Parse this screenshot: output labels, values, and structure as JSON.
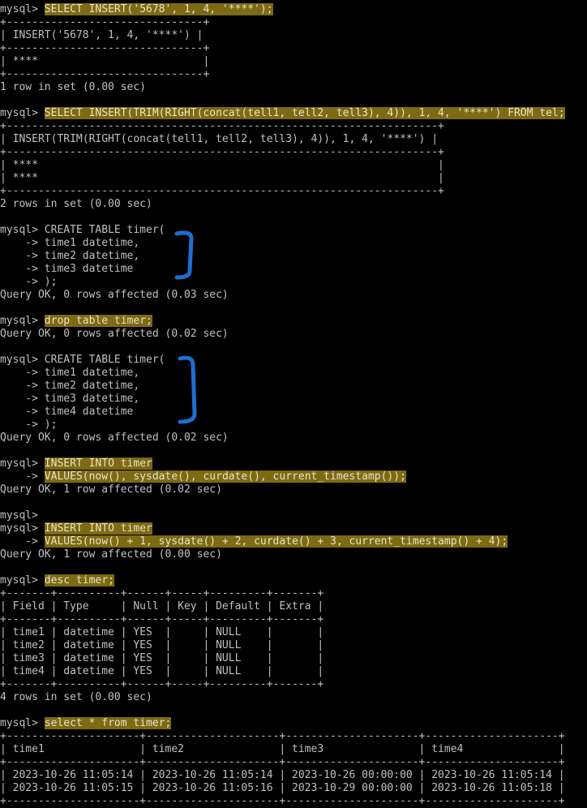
{
  "terminal": {
    "highlight_color": "#7d6a12",
    "text_color": "#c0c0c0",
    "background": "#000000",
    "annotation_color": "#1e6fd0",
    "lines": [
      {
        "segs": [
          {
            "t": "mysql> "
          },
          {
            "t": "SELECT INSERT('5678', 1, 4, '****');",
            "hl": true
          }
        ]
      },
      {
        "segs": [
          {
            "t": "+-------------------------------+"
          }
        ]
      },
      {
        "segs": [
          {
            "t": "| INSERT('5678', 1, 4, '****') |"
          }
        ]
      },
      {
        "segs": [
          {
            "t": "+-------------------------------+"
          }
        ]
      },
      {
        "segs": [
          {
            "t": "| ****                          |"
          }
        ]
      },
      {
        "segs": [
          {
            "t": "+-------------------------------+"
          }
        ]
      },
      {
        "segs": [
          {
            "t": "1 row in set (0.00 sec)"
          }
        ]
      },
      {
        "segs": [
          {
            "t": ""
          }
        ]
      },
      {
        "segs": [
          {
            "t": "mysql> "
          },
          {
            "t": "SELECT INSERT(TRIM(RIGHT(concat(tell1, tell2, tell3), 4)), 1, 4, '****') FROM tel;",
            "hl": true
          }
        ]
      },
      {
        "segs": [
          {
            "t": "+--------------------------------------------------------------------+"
          }
        ]
      },
      {
        "segs": [
          {
            "t": "| INSERT(TRIM(RIGHT(concat(tell1, tell2, tell3), 4)), 1, 4, '****') |"
          }
        ]
      },
      {
        "segs": [
          {
            "t": "+--------------------------------------------------------------------+"
          }
        ]
      },
      {
        "segs": [
          {
            "t": "| ****                                                               |"
          }
        ]
      },
      {
        "segs": [
          {
            "t": "| ****                                                               |"
          }
        ]
      },
      {
        "segs": [
          {
            "t": "+--------------------------------------------------------------------+"
          }
        ]
      },
      {
        "segs": [
          {
            "t": "2 rows in set (0.00 sec)"
          }
        ]
      },
      {
        "segs": [
          {
            "t": ""
          }
        ]
      },
      {
        "segs": [
          {
            "t": "mysql> CREATE TABLE timer("
          }
        ]
      },
      {
        "segs": [
          {
            "t": "    -> time1 datetime,"
          }
        ]
      },
      {
        "segs": [
          {
            "t": "    -> time2 datetime,"
          }
        ]
      },
      {
        "segs": [
          {
            "t": "    -> time3 datetime"
          }
        ]
      },
      {
        "segs": [
          {
            "t": "    -> );"
          }
        ]
      },
      {
        "segs": [
          {
            "t": "Query OK, 0 rows affected (0.03 sec)"
          }
        ]
      },
      {
        "segs": [
          {
            "t": ""
          }
        ]
      },
      {
        "segs": [
          {
            "t": "mysql> "
          },
          {
            "t": "drop table timer;",
            "hl": true
          }
        ]
      },
      {
        "segs": [
          {
            "t": "Query OK, 0 rows affected (0.02 sec)"
          }
        ]
      },
      {
        "segs": [
          {
            "t": ""
          }
        ]
      },
      {
        "segs": [
          {
            "t": "mysql> CREATE TABLE timer("
          }
        ]
      },
      {
        "segs": [
          {
            "t": "    -> time1 datetime,"
          }
        ]
      },
      {
        "segs": [
          {
            "t": "    -> time2 datetime,"
          }
        ]
      },
      {
        "segs": [
          {
            "t": "    -> time3 datetime,"
          }
        ]
      },
      {
        "segs": [
          {
            "t": "    -> time4 datetime"
          }
        ]
      },
      {
        "segs": [
          {
            "t": "    -> );"
          }
        ]
      },
      {
        "segs": [
          {
            "t": "Query OK, 0 rows affected (0.02 sec)"
          }
        ]
      },
      {
        "segs": [
          {
            "t": ""
          }
        ]
      },
      {
        "segs": [
          {
            "t": "mysql> "
          },
          {
            "t": "INSERT INTO timer",
            "hl": true
          }
        ]
      },
      {
        "segs": [
          {
            "t": "    -> "
          },
          {
            "t": "VALUES(now(), sysdate(), curdate(), current_timestamp());",
            "hl": true
          }
        ]
      },
      {
        "segs": [
          {
            "t": "Query OK, 1 row affected (0.02 sec)"
          }
        ]
      },
      {
        "segs": [
          {
            "t": ""
          }
        ]
      },
      {
        "segs": [
          {
            "t": "mysql>"
          }
        ]
      },
      {
        "segs": [
          {
            "t": "mysql> "
          },
          {
            "t": "INSERT INTO timer",
            "hl": true
          }
        ]
      },
      {
        "segs": [
          {
            "t": "    -> "
          },
          {
            "t": "VALUES(now() + 1, sysdate() + 2, curdate() + 3, current_timestamp() + 4);",
            "hl": true
          }
        ]
      },
      {
        "segs": [
          {
            "t": "Query OK, 1 row affected (0.00 sec)"
          }
        ]
      },
      {
        "segs": [
          {
            "t": ""
          }
        ]
      },
      {
        "segs": [
          {
            "t": "mysql> "
          },
          {
            "t": "desc timer;",
            "hl": true
          }
        ]
      },
      {
        "segs": [
          {
            "t": "+-------+----------+------+-----+---------+-------+"
          }
        ]
      },
      {
        "segs": [
          {
            "t": "| Field | Type     | Null | Key | Default | Extra |"
          }
        ]
      },
      {
        "segs": [
          {
            "t": "+-------+----------+------+-----+---------+-------+"
          }
        ]
      },
      {
        "segs": [
          {
            "t": "| time1 | datetime | YES  |     | NULL    |       |"
          }
        ]
      },
      {
        "segs": [
          {
            "t": "| time2 | datetime | YES  |     | NULL    |       |"
          }
        ]
      },
      {
        "segs": [
          {
            "t": "| time3 | datetime | YES  |     | NULL    |       |"
          }
        ]
      },
      {
        "segs": [
          {
            "t": "| time4 | datetime | YES  |     | NULL    |       |"
          }
        ]
      },
      {
        "segs": [
          {
            "t": "+-------+----------+------+-----+---------+-------+"
          }
        ]
      },
      {
        "segs": [
          {
            "t": "4 rows in set (0.00 sec)"
          }
        ]
      },
      {
        "segs": [
          {
            "t": ""
          }
        ]
      },
      {
        "segs": [
          {
            "t": "mysql> "
          },
          {
            "t": "select * from timer;",
            "hl": true
          }
        ]
      },
      {
        "segs": [
          {
            "t": "+---------------------+---------------------+---------------------+---------------------+"
          }
        ]
      },
      {
        "segs": [
          {
            "t": "| time1               | time2               | time3               | time4               |"
          }
        ]
      },
      {
        "segs": [
          {
            "t": "+---------------------+---------------------+---------------------+---------------------+"
          }
        ]
      },
      {
        "segs": [
          {
            "t": "| 2023-10-26 11:05:14 | 2023-10-26 11:05:14 | 2023-10-26 00:00:00 | 2023-10-26 11:05:14 |"
          }
        ]
      },
      {
        "segs": [
          {
            "t": "| 2023-10-26 11:05:15 | 2023-10-26 11:05:16 | 2023-10-29 00:00:00 | 2023-10-26 11:05:18 |"
          }
        ]
      },
      {
        "segs": [
          {
            "t": "+---------------------+---------------------+---------------------+---------------------+"
          }
        ]
      }
    ]
  }
}
